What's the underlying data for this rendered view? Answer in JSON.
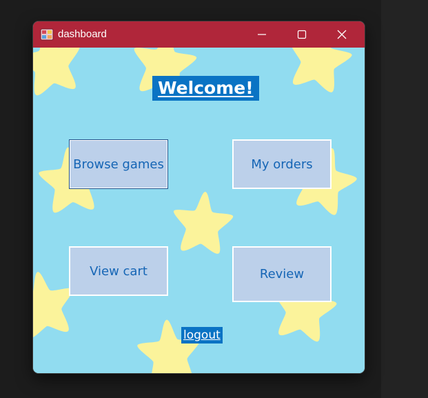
{
  "window": {
    "title": "dashboard",
    "icon": "app-window-icon",
    "controls": [
      "minimize-icon",
      "maximize-icon",
      "close-icon"
    ],
    "titlebar_color": "#b0263a"
  },
  "dashboard": {
    "welcome": "Welcome!",
    "buttons": {
      "browse": "Browse games",
      "orders": "My orders",
      "cart": "View cart",
      "review": "Review"
    },
    "logout": "logout"
  },
  "colors": {
    "background": "#91dcf0",
    "star": "#fbf39b",
    "button_fill": "#bcd0ea",
    "button_text": "#1565b5",
    "label_highlight": "#0a73c4"
  }
}
